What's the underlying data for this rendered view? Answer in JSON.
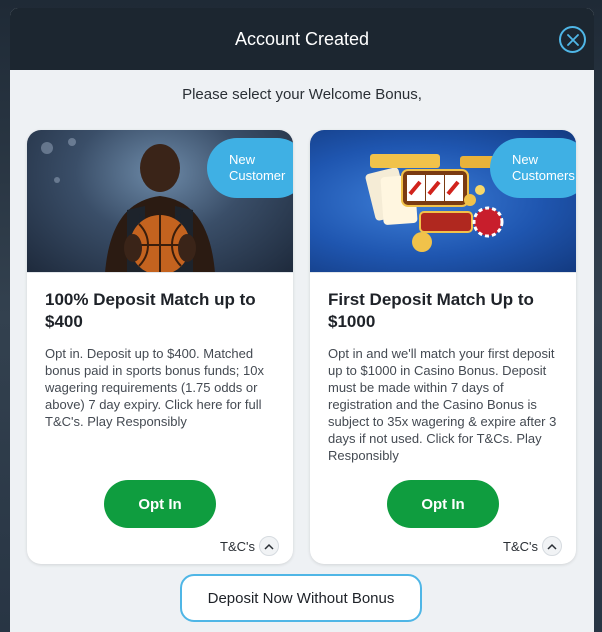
{
  "header": {
    "title": "Account Created",
    "close_icon": "close-icon"
  },
  "subtitle": "Please select your Welcome Bonus,",
  "cards": [
    {
      "badge_line1": "New",
      "badge_line2": "Customer",
      "image": "basketball-player-image",
      "title": "100% Deposit Match up to $400",
      "description": "Opt in. Deposit up to $400. Matched bonus paid in sports bonus funds; 10x wagering requirements (1.75 odds or above) 7 day expiry. Click here for full T&C's. Play Responsibly",
      "opt_in_label": "Opt In",
      "tnc_label": "T&C's"
    },
    {
      "badge_line1": "New",
      "badge_line2": "Customers",
      "image": "casino-slots-image",
      "title": "First Deposit Match Up to $1000",
      "description": "Opt in and we'll match your first deposit up to $1000 in Casino Bonus. Deposit must be made within 7 days of registration and the Casino Bonus is subject to 35x wagering & expire after 3 days if not used. Click for T&Cs. Play Responsibly",
      "opt_in_label": "Opt In",
      "tnc_label": "T&C's"
    }
  ],
  "no_bonus_label": "Deposit Now Without Bonus",
  "colors": {
    "accent": "#4fb6e6",
    "opt_in_green": "#0f9d3f",
    "header_bg": "#1c2630",
    "badge_bg": "#3fb0e4"
  }
}
